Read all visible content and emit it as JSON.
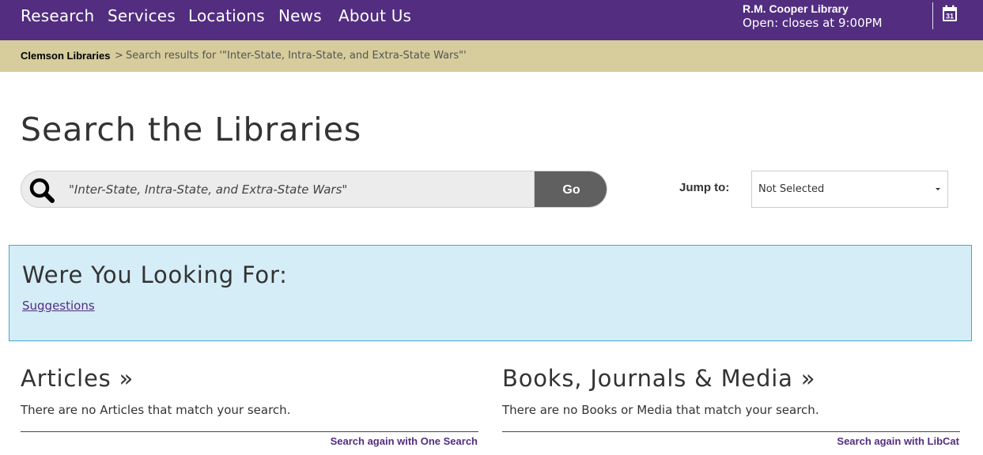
{
  "nav": {
    "items": [
      "Research",
      "Services",
      "Locations",
      "News",
      "About Us"
    ],
    "library_name": "R.M. Cooper Library",
    "library_hours": "Open: closes at 9:00PM",
    "calendar_day": "31",
    "brand_color": "#522d80"
  },
  "breadcrumb": {
    "home": "Clemson Libraries",
    "separator": ">",
    "current": "Search results for '\"Inter-State, Intra-State, and Extra-State Wars\"'"
  },
  "page": {
    "title": "Search the Libraries"
  },
  "search": {
    "query": "\"Inter-State, Intra-State, and Extra-State Wars\"",
    "go_label": "Go",
    "jump_label": "Jump to:",
    "jump_selected": "Not Selected"
  },
  "suggestions": {
    "title": "Were You Looking For:",
    "link": "Suggestions"
  },
  "sections": {
    "articles": {
      "title": "Articles »",
      "empty": "There are no Articles that match your search.",
      "again": "Search again with One Search"
    },
    "books": {
      "title": "Books, Journals & Media »",
      "empty": "There are no Books or Media that match your search.",
      "again": "Search again with LibCat"
    }
  }
}
